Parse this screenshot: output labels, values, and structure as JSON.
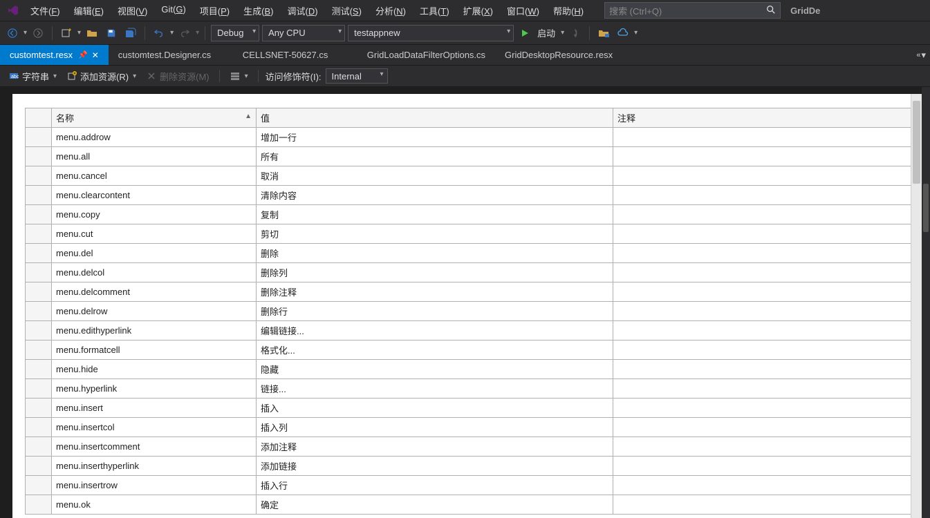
{
  "menu": {
    "items": [
      {
        "pre": "文件(",
        "u": "F",
        "post": ")"
      },
      {
        "pre": "编辑(",
        "u": "E",
        "post": ")"
      },
      {
        "pre": "视图(",
        "u": "V",
        "post": ")"
      },
      {
        "pre": "Git(",
        "u": "G",
        "post": ")"
      },
      {
        "pre": "项目(",
        "u": "P",
        "post": ")"
      },
      {
        "pre": "生成(",
        "u": "B",
        "post": ")"
      },
      {
        "pre": "调试(",
        "u": "D",
        "post": ")"
      },
      {
        "pre": "测试(",
        "u": "S",
        "post": ")"
      },
      {
        "pre": "分析(",
        "u": "N",
        "post": ")"
      },
      {
        "pre": "工具(",
        "u": "T",
        "post": ")"
      },
      {
        "pre": "扩展(",
        "u": "X",
        "post": ")"
      },
      {
        "pre": "窗口(",
        "u": "W",
        "post": ")"
      },
      {
        "pre": "帮助(",
        "u": "H",
        "post": ")"
      }
    ],
    "search_placeholder": "搜索 (Ctrl+Q)",
    "brand": "GridDe"
  },
  "toolbar": {
    "config": "Debug",
    "platform": "Any CPU",
    "startup": "testappnew",
    "start_label": "启动"
  },
  "tabs": [
    {
      "label": "customtest.resx",
      "active": true,
      "pinned": true
    },
    {
      "label": "customtest.Designer.cs"
    },
    {
      "label": "CELLSNET-50627.cs"
    },
    {
      "label": "GridLoadDataFilterOptions.cs"
    },
    {
      "label": "GridDesktopResource.resx"
    }
  ],
  "resbar": {
    "strings_label": "字符串",
    "add_label": "添加资源(R)",
    "remove_label": "删除资源(M)",
    "access_label": "访问修饰符(I):",
    "access_value": "Internal"
  },
  "grid": {
    "headers": {
      "name": "名称",
      "value": "值",
      "comment": "注释"
    },
    "rows": [
      {
        "name": "menu.addrow",
        "value": "增加一行",
        "comment": ""
      },
      {
        "name": "menu.all",
        "value": "所有",
        "comment": ""
      },
      {
        "name": "menu.cancel",
        "value": "取消",
        "comment": ""
      },
      {
        "name": "menu.clearcontent",
        "value": "清除内容",
        "comment": ""
      },
      {
        "name": "menu.copy",
        "value": "复制",
        "comment": ""
      },
      {
        "name": "menu.cut",
        "value": "剪切",
        "comment": ""
      },
      {
        "name": "menu.del",
        "value": "删除",
        "comment": ""
      },
      {
        "name": "menu.delcol",
        "value": "删除列",
        "comment": ""
      },
      {
        "name": "menu.delcomment",
        "value": "删除注释",
        "comment": ""
      },
      {
        "name": "menu.delrow",
        "value": "删除行",
        "comment": ""
      },
      {
        "name": "menu.edithyperlink",
        "value": "编辑链接...",
        "comment": ""
      },
      {
        "name": "menu.formatcell",
        "value": "格式化...",
        "comment": ""
      },
      {
        "name": "menu.hide",
        "value": "隐藏",
        "comment": ""
      },
      {
        "name": "menu.hyperlink",
        "value": "链接...",
        "comment": ""
      },
      {
        "name": "menu.insert",
        "value": "插入",
        "comment": ""
      },
      {
        "name": "menu.insertcol",
        "value": "插入列",
        "comment": ""
      },
      {
        "name": "menu.insertcomment",
        "value": "添加注释",
        "comment": ""
      },
      {
        "name": "menu.inserthyperlink",
        "value": "添加链接",
        "comment": ""
      },
      {
        "name": "menu.insertrow",
        "value": "插入行",
        "comment": ""
      },
      {
        "name": "menu.ok",
        "value": "确定",
        "comment": ""
      }
    ]
  }
}
